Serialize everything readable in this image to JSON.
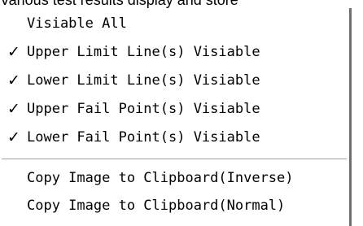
{
  "caption": "Various test results display and store",
  "menu": {
    "items": [
      {
        "label": "Visiable All",
        "check": ""
      },
      {
        "label": "Upper Limit Line(s) Visiable",
        "check": "✓"
      },
      {
        "label": "Lower Limit Line(s) Visiable",
        "check": "✓"
      },
      {
        "label": "Upper Fail Point(s) Visiable",
        "check": "✓"
      },
      {
        "label": "Lower Fail Point(s) Visiable",
        "check": "✓"
      },
      {
        "label": "Copy Image to Clipboard(Inverse)",
        "check": ""
      },
      {
        "label": "Copy Image to Clipboard(Normal)",
        "check": ""
      }
    ]
  },
  "icons": {
    "checkmark": "checkmark-icon"
  }
}
